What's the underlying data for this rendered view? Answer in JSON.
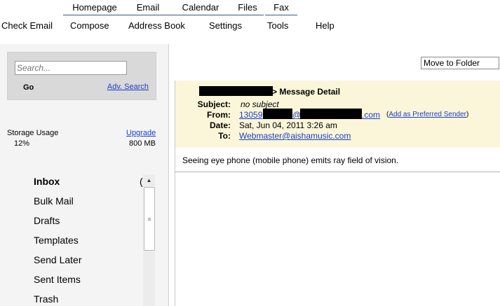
{
  "tabs": [
    "Homepage",
    "Email",
    "Calendar",
    "Files",
    "Fax"
  ],
  "nav": [
    "Check Email",
    "Compose",
    "Address Book",
    "Settings",
    "Tools",
    "Help"
  ],
  "search": {
    "placeholder": "Search...",
    "go_label": "Go",
    "advanced_label": "Adv. Search"
  },
  "storage": {
    "label": "Storage Usage",
    "percent": "12%",
    "upgrade_label": "Upgrade",
    "total": "800 MB"
  },
  "folders": [
    "Inbox",
    "Bulk Mail",
    "Drafts",
    "Templates",
    "Send Later",
    "Sent Items",
    "Trash"
  ],
  "inbox_count_glyph": "(",
  "move_to_folder": "Move to Folder",
  "message": {
    "title_suffix": "> Message Detail",
    "subject_label": "Subject:",
    "subject": "no subject",
    "from_label": "From:",
    "from_prefix": "13059",
    "from_at": "@",
    "from_suffix": ".com",
    "add_sender": "Add as Preferred Sender",
    "date_label": "Date:",
    "date": "Sat, Jun 04, 2011 3:26 am",
    "to_label": "To:",
    "to": "Webmaster@aishamusic.com",
    "body": "Seeing eye phone (mobile phone) emits ray field of vision."
  },
  "colors": {
    "link": "#1a3ec8",
    "header_bg": "#fbf6d9",
    "left_panel_bg": "#f4f4f4"
  }
}
